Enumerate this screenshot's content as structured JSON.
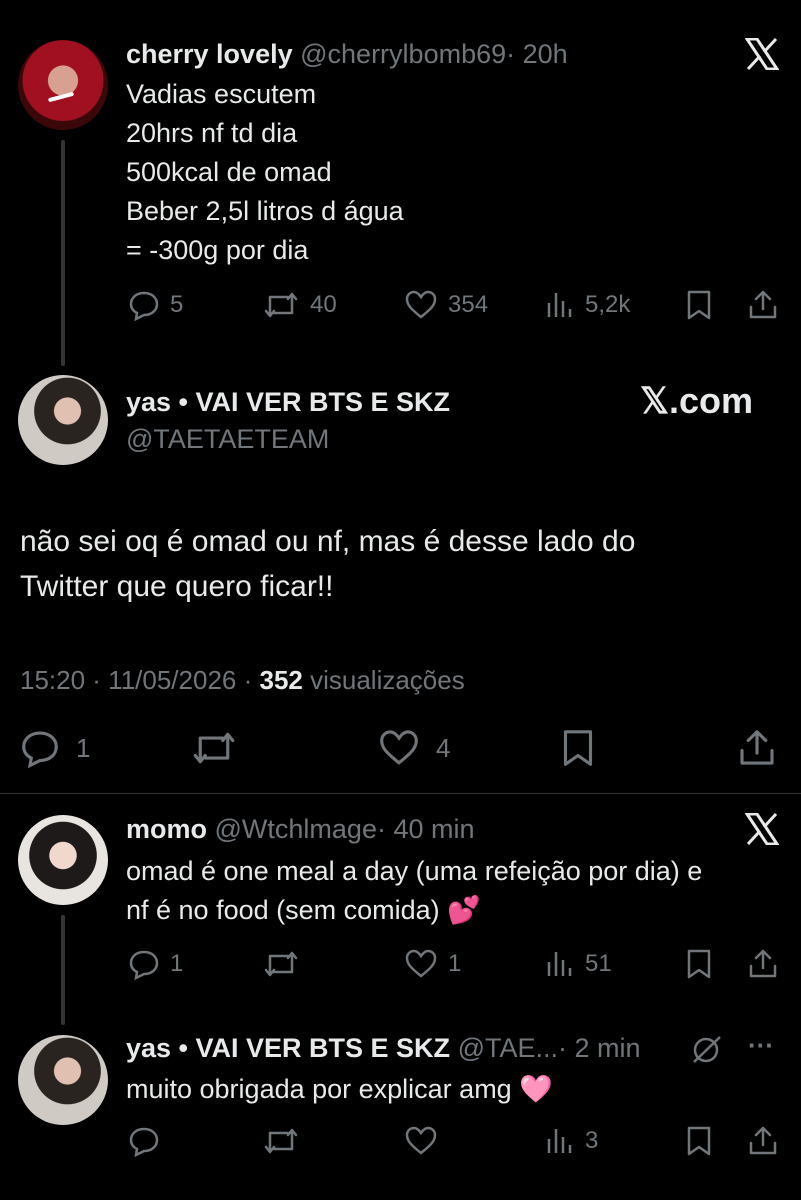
{
  "tweet1": {
    "display_name": "cherry lovely",
    "handle": "@cherrylbomb69",
    "time": "· 20h",
    "lines": [
      "Vadias escutem",
      "20hrs nf td dia",
      "500kcal de omad",
      "Beber 2,5l litros d água",
      "= -300g por dia"
    ],
    "replies": "5",
    "reposts": "40",
    "likes": "354",
    "views": "5,2k"
  },
  "main": {
    "display_name": "yas • VAI VER BTS E SKZ",
    "handle": "@TAETAETEAM",
    "brand": "𝕏.com",
    "text_lines": [
      "não sei oq é omad ou nf, mas é desse lado do",
      "Twitter que quero ficar!!"
    ],
    "timestamp": "15:20 · 11/05/2026 · ",
    "views_count": "352",
    "views_label": " visualizações",
    "replies": "1",
    "likes": "4"
  },
  "reply1": {
    "display_name": "momo",
    "handle": "@Wtchlmage",
    "time": "· 40 min",
    "lines": [
      "omad é one meal a day (uma refeição por dia) e",
      "nf é no food (sem comida) 💕"
    ],
    "replies": "1",
    "likes": "1",
    "views": "51"
  },
  "reply2": {
    "display_name": "yas • VAI VER BTS E SKZ",
    "handle": "@TAE...",
    "time": "· 2 min",
    "more": "···",
    "lines": [
      "muito obrigada por explicar amg 🩷"
    ],
    "views": "3"
  }
}
